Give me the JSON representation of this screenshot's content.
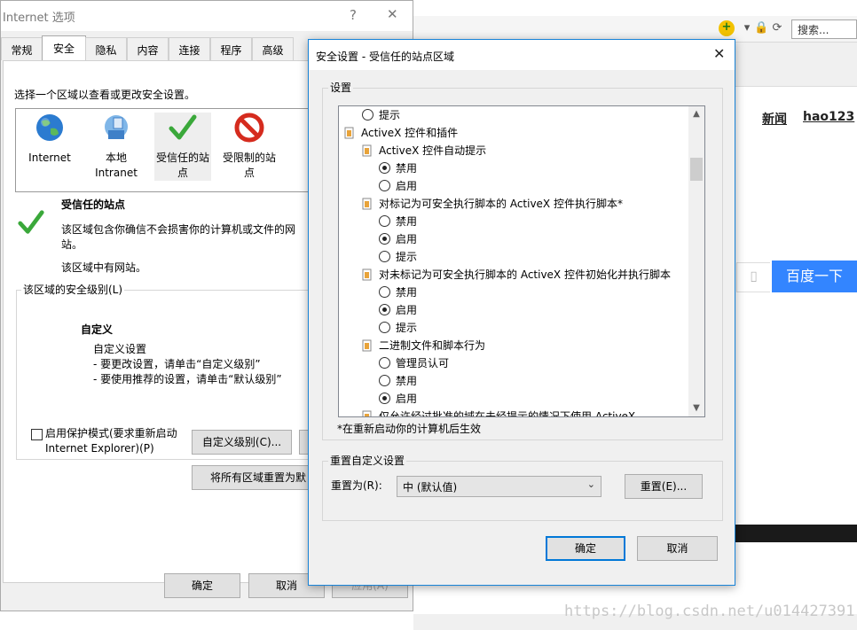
{
  "browser": {
    "search_placeholder": "搜索...",
    "nav_links": [
      "新闻",
      "hao123"
    ],
    "search_button": "百度一下",
    "watermark": "https://blog.csdn.net/u014427391"
  },
  "internet_options": {
    "title": "Internet 选项",
    "title_buttons": {
      "help": "?",
      "close": "✕"
    },
    "tabs": [
      "常规",
      "安全",
      "隐私",
      "内容",
      "连接",
      "程序",
      "高级"
    ],
    "active_tab": "安全",
    "instruction": "选择一个区域以查看或更改安全设置。",
    "zones": [
      {
        "label": "Internet",
        "icon": "globe-icon"
      },
      {
        "label": "本地\nIntranet",
        "icon": "intranet-icon"
      },
      {
        "label": "受信任的站\n点",
        "icon": "checkmark-icon"
      },
      {
        "label": "受限制的站\n点",
        "icon": "restricted-icon"
      }
    ],
    "selected_zone": {
      "name": "受信任的站点",
      "desc": "该区域包含你确信不会损害你的计算机或文件的网站。",
      "note": "该区域中有网站。"
    },
    "security_level": {
      "group_label": "该区域的安全级别(L)",
      "level_title": "自定义",
      "line1": "自定义设置",
      "line2": "- 要更改设置，请单击“自定义级别”",
      "line3": "- 要使用推荐的设置，请单击“默认级别”"
    },
    "protected_mode": "启用保护模式(要求重新启动 Internet Explorer)(P)",
    "buttons": {
      "custom_level": "自定义级别(C)...",
      "reset_all": "将所有区域重置为默",
      "ok": "确定",
      "cancel": "取消",
      "apply": "应用(A)"
    }
  },
  "security_settings": {
    "title": "安全设置 - 受信任的站点区域",
    "close_glyph": "✕",
    "settings_group": "设置",
    "list": [
      {
        "kind": "radio",
        "indent": 1,
        "label": "提示",
        "checked": false
      },
      {
        "kind": "category",
        "indent": 0,
        "label": "ActiveX 控件和插件"
      },
      {
        "kind": "setting",
        "indent": 1,
        "label": "ActiveX 控件自动提示"
      },
      {
        "kind": "radio",
        "indent": 2,
        "label": "禁用",
        "checked": true
      },
      {
        "kind": "radio",
        "indent": 2,
        "label": "启用",
        "checked": false
      },
      {
        "kind": "setting",
        "indent": 1,
        "label": "对标记为可安全执行脚本的 ActiveX 控件执行脚本*"
      },
      {
        "kind": "radio",
        "indent": 2,
        "label": "禁用",
        "checked": false
      },
      {
        "kind": "radio",
        "indent": 2,
        "label": "启用",
        "checked": true
      },
      {
        "kind": "radio",
        "indent": 2,
        "label": "提示",
        "checked": false
      },
      {
        "kind": "setting",
        "indent": 1,
        "label": "对未标记为可安全执行脚本的 ActiveX 控件初始化并执行脚本"
      },
      {
        "kind": "radio",
        "indent": 2,
        "label": "禁用",
        "checked": false
      },
      {
        "kind": "radio",
        "indent": 2,
        "label": "启用",
        "checked": true
      },
      {
        "kind": "radio",
        "indent": 2,
        "label": "提示",
        "checked": false
      },
      {
        "kind": "setting",
        "indent": 1,
        "label": "二进制文件和脚本行为"
      },
      {
        "kind": "radio",
        "indent": 2,
        "label": "管理员认可",
        "checked": false
      },
      {
        "kind": "radio",
        "indent": 2,
        "label": "禁用",
        "checked": false
      },
      {
        "kind": "radio",
        "indent": 2,
        "label": "启用",
        "checked": true
      },
      {
        "kind": "setting",
        "indent": 1,
        "label": "仅允许经过批准的域在未经提示的情况下使用 ActiveX"
      }
    ],
    "restart_note": "*在重新启动你的计算机后生效",
    "reset_group": "重置自定义设置",
    "reset_to_label": "重置为(R):",
    "reset_select_value": "中 (默认值)",
    "reset_button": "重置(E)...",
    "ok": "确定",
    "cancel": "取消"
  }
}
